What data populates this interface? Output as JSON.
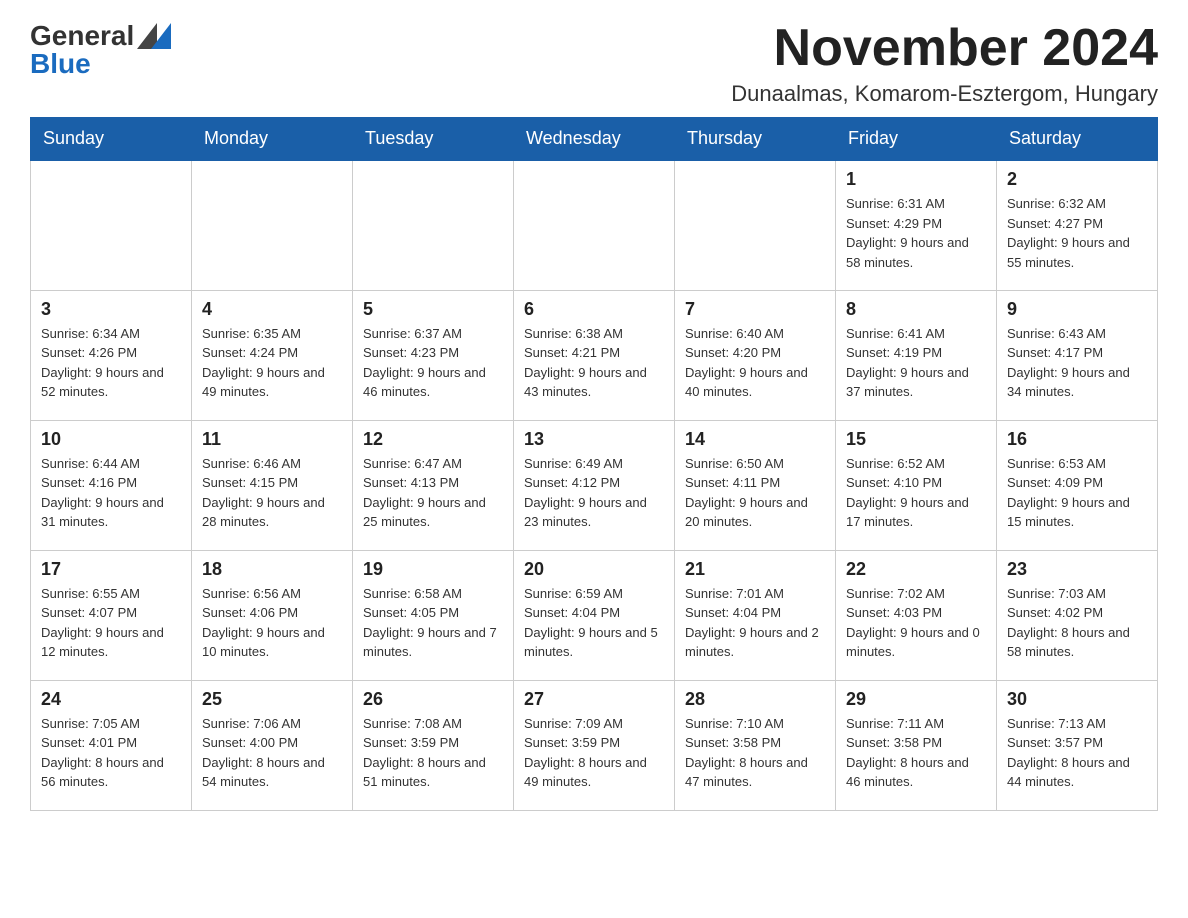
{
  "header": {
    "month_year": "November 2024",
    "location": "Dunaalmas, Komarom-Esztergom, Hungary",
    "logo_general": "General",
    "logo_blue": "Blue"
  },
  "weekdays": [
    "Sunday",
    "Monday",
    "Tuesday",
    "Wednesday",
    "Thursday",
    "Friday",
    "Saturday"
  ],
  "weeks": [
    [
      {
        "day": "",
        "info": ""
      },
      {
        "day": "",
        "info": ""
      },
      {
        "day": "",
        "info": ""
      },
      {
        "day": "",
        "info": ""
      },
      {
        "day": "",
        "info": ""
      },
      {
        "day": "1",
        "info": "Sunrise: 6:31 AM\nSunset: 4:29 PM\nDaylight: 9 hours and 58 minutes."
      },
      {
        "day": "2",
        "info": "Sunrise: 6:32 AM\nSunset: 4:27 PM\nDaylight: 9 hours and 55 minutes."
      }
    ],
    [
      {
        "day": "3",
        "info": "Sunrise: 6:34 AM\nSunset: 4:26 PM\nDaylight: 9 hours and 52 minutes."
      },
      {
        "day": "4",
        "info": "Sunrise: 6:35 AM\nSunset: 4:24 PM\nDaylight: 9 hours and 49 minutes."
      },
      {
        "day": "5",
        "info": "Sunrise: 6:37 AM\nSunset: 4:23 PM\nDaylight: 9 hours and 46 minutes."
      },
      {
        "day": "6",
        "info": "Sunrise: 6:38 AM\nSunset: 4:21 PM\nDaylight: 9 hours and 43 minutes."
      },
      {
        "day": "7",
        "info": "Sunrise: 6:40 AM\nSunset: 4:20 PM\nDaylight: 9 hours and 40 minutes."
      },
      {
        "day": "8",
        "info": "Sunrise: 6:41 AM\nSunset: 4:19 PM\nDaylight: 9 hours and 37 minutes."
      },
      {
        "day": "9",
        "info": "Sunrise: 6:43 AM\nSunset: 4:17 PM\nDaylight: 9 hours and 34 minutes."
      }
    ],
    [
      {
        "day": "10",
        "info": "Sunrise: 6:44 AM\nSunset: 4:16 PM\nDaylight: 9 hours and 31 minutes."
      },
      {
        "day": "11",
        "info": "Sunrise: 6:46 AM\nSunset: 4:15 PM\nDaylight: 9 hours and 28 minutes."
      },
      {
        "day": "12",
        "info": "Sunrise: 6:47 AM\nSunset: 4:13 PM\nDaylight: 9 hours and 25 minutes."
      },
      {
        "day": "13",
        "info": "Sunrise: 6:49 AM\nSunset: 4:12 PM\nDaylight: 9 hours and 23 minutes."
      },
      {
        "day": "14",
        "info": "Sunrise: 6:50 AM\nSunset: 4:11 PM\nDaylight: 9 hours and 20 minutes."
      },
      {
        "day": "15",
        "info": "Sunrise: 6:52 AM\nSunset: 4:10 PM\nDaylight: 9 hours and 17 minutes."
      },
      {
        "day": "16",
        "info": "Sunrise: 6:53 AM\nSunset: 4:09 PM\nDaylight: 9 hours and 15 minutes."
      }
    ],
    [
      {
        "day": "17",
        "info": "Sunrise: 6:55 AM\nSunset: 4:07 PM\nDaylight: 9 hours and 12 minutes."
      },
      {
        "day": "18",
        "info": "Sunrise: 6:56 AM\nSunset: 4:06 PM\nDaylight: 9 hours and 10 minutes."
      },
      {
        "day": "19",
        "info": "Sunrise: 6:58 AM\nSunset: 4:05 PM\nDaylight: 9 hours and 7 minutes."
      },
      {
        "day": "20",
        "info": "Sunrise: 6:59 AM\nSunset: 4:04 PM\nDaylight: 9 hours and 5 minutes."
      },
      {
        "day": "21",
        "info": "Sunrise: 7:01 AM\nSunset: 4:04 PM\nDaylight: 9 hours and 2 minutes."
      },
      {
        "day": "22",
        "info": "Sunrise: 7:02 AM\nSunset: 4:03 PM\nDaylight: 9 hours and 0 minutes."
      },
      {
        "day": "23",
        "info": "Sunrise: 7:03 AM\nSunset: 4:02 PM\nDaylight: 8 hours and 58 minutes."
      }
    ],
    [
      {
        "day": "24",
        "info": "Sunrise: 7:05 AM\nSunset: 4:01 PM\nDaylight: 8 hours and 56 minutes."
      },
      {
        "day": "25",
        "info": "Sunrise: 7:06 AM\nSunset: 4:00 PM\nDaylight: 8 hours and 54 minutes."
      },
      {
        "day": "26",
        "info": "Sunrise: 7:08 AM\nSunset: 3:59 PM\nDaylight: 8 hours and 51 minutes."
      },
      {
        "day": "27",
        "info": "Sunrise: 7:09 AM\nSunset: 3:59 PM\nDaylight: 8 hours and 49 minutes."
      },
      {
        "day": "28",
        "info": "Sunrise: 7:10 AM\nSunset: 3:58 PM\nDaylight: 8 hours and 47 minutes."
      },
      {
        "day": "29",
        "info": "Sunrise: 7:11 AM\nSunset: 3:58 PM\nDaylight: 8 hours and 46 minutes."
      },
      {
        "day": "30",
        "info": "Sunrise: 7:13 AM\nSunset: 3:57 PM\nDaylight: 8 hours and 44 minutes."
      }
    ]
  ]
}
